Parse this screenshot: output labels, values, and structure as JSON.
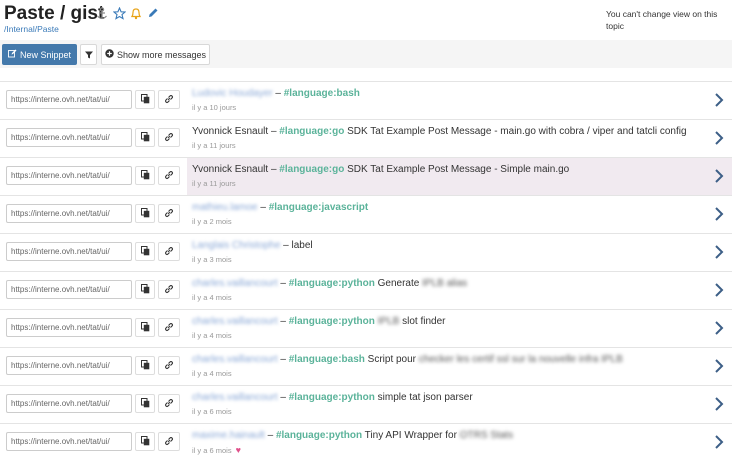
{
  "header": {
    "title": "Paste / gist",
    "breadcrumb": "/Internal/Paste",
    "notice": "You can't change view on this topic",
    "icons": [
      "anchor-icon",
      "star-icon",
      "bell-icon",
      "pencil-icon"
    ]
  },
  "toolbar": {
    "new_snippet_label": "New Snippet",
    "filter_icon": "filter-icon",
    "show_more_label": "Show more messages"
  },
  "colors": {
    "primary_button": "#4479ab",
    "tag": "#5bb39a",
    "author_link": "#8aa8d6",
    "highlight_row": "#f1eaf0",
    "heart": "#e0508a"
  },
  "messages": [
    {
      "url": "https://interne.ovh.net/tat/ui/",
      "author": "Ludovic Houdayer",
      "sep": " – ",
      "tag": "#language:bash",
      "text": "",
      "text_blur": "",
      "time": "il y a 10 jours"
    },
    {
      "url": "https://interne.ovh.net/tat/ui/",
      "author": "Yvonnick Esnault",
      "sep": " – ",
      "tag": "#language:go",
      "text": "SDK Tat Example Post Message - main.go with cobra / viper and tatcli config",
      "text_blur": "",
      "time": "il y a 11 jours"
    },
    {
      "url": "https://interne.ovh.net/tat/ui/",
      "author": "Yvonnick Esnault",
      "sep": " – ",
      "tag": "#language:go",
      "text": "SDK Tat Example Post Message - Simple main.go",
      "text_blur": "",
      "time": "il y a 11 jours"
    },
    {
      "url": "https://interne.ovh.net/tat/ui/",
      "author": "mathieu.lamoe",
      "sep": " – ",
      "tag": "#language:javascript",
      "text": "",
      "text_blur": "",
      "time": "il y a 2 mois"
    },
    {
      "url": "https://interne.ovh.net/tat/ui/",
      "author": "Langlais Christophe",
      "sep": " – ",
      "tag": "",
      "text": "label",
      "text_blur": "",
      "time": "il y a 3 mois"
    },
    {
      "url": "https://interne.ovh.net/tat/ui/",
      "author": "charles.vaillancourt",
      "sep": " – ",
      "tag": "#language:python",
      "text": "Generate",
      "text_blur": "IPLB alias",
      "time": "il y a 4 mois"
    },
    {
      "url": "https://interne.ovh.net/tat/ui/",
      "author": "charles.vaillancourt",
      "sep": " – ",
      "tag": "#language:python",
      "text": "",
      "text_blur": "IPLB",
      "text_after": "slot finder",
      "time": "il y a 4 mois"
    },
    {
      "url": "https://interne.ovh.net/tat/ui/",
      "author": "charles.vaillancourt",
      "sep": " – ",
      "tag": "#language:bash",
      "text": "Script pour",
      "text_blur": "checker les certif ssl sur la nouvelle infra IPLB",
      "time": "il y a 4 mois"
    },
    {
      "url": "https://interne.ovh.net/tat/ui/",
      "author": "charles.vaillancourt",
      "sep": " – ",
      "tag": "#language:python",
      "text": "simple tat json parser",
      "text_blur": "",
      "time": "il y a 6 mois"
    },
    {
      "url": "https://interne.ovh.net/tat/ui/",
      "author": "maxime.hainault",
      "sep": " – ",
      "tag": "#language:python",
      "text": "Tiny API Wrapper for",
      "text_blur": "OTRS Stats",
      "time": "il y a 6 mois",
      "heart": "♥"
    }
  ]
}
